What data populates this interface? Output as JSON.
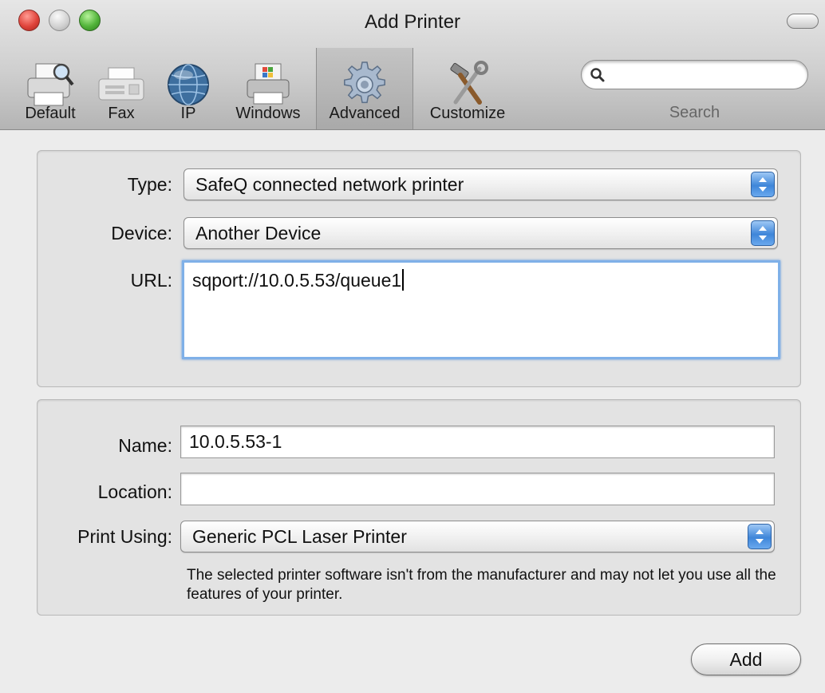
{
  "window": {
    "title": "Add Printer"
  },
  "toolbar": {
    "items": [
      {
        "label": "Default",
        "icon": "default-printer-icon"
      },
      {
        "label": "Fax",
        "icon": "fax-icon"
      },
      {
        "label": "IP",
        "icon": "ip-globe-icon"
      },
      {
        "label": "Windows",
        "icon": "windows-printer-icon"
      },
      {
        "label": "Advanced",
        "icon": "gear-icon",
        "selected": true
      },
      {
        "label": "Customize",
        "icon": "tools-icon"
      }
    ],
    "search": {
      "label": "Search",
      "value": "",
      "icon": "search-icon"
    }
  },
  "connection": {
    "type_label": "Type:",
    "type_value": "SafeQ connected network printer",
    "device_label": "Device:",
    "device_value": "Another Device",
    "url_label": "URL:",
    "url_value": "sqport://10.0.5.53/queue1"
  },
  "printer": {
    "name_label": "Name:",
    "name_value": "10.0.5.53-1",
    "location_label": "Location:",
    "location_value": "",
    "print_using_label": "Print Using:",
    "print_using_value": "Generic PCL Laser Printer",
    "note": "The selected printer software isn't from the manufacturer and may not let you use all the features of your printer."
  },
  "actions": {
    "add_label": "Add"
  },
  "colors": {
    "accent_blue": "#3f86d9",
    "focus_ring": "#7fb0e8",
    "close_red": "#e0443b",
    "zoom_green": "#52b43a"
  }
}
